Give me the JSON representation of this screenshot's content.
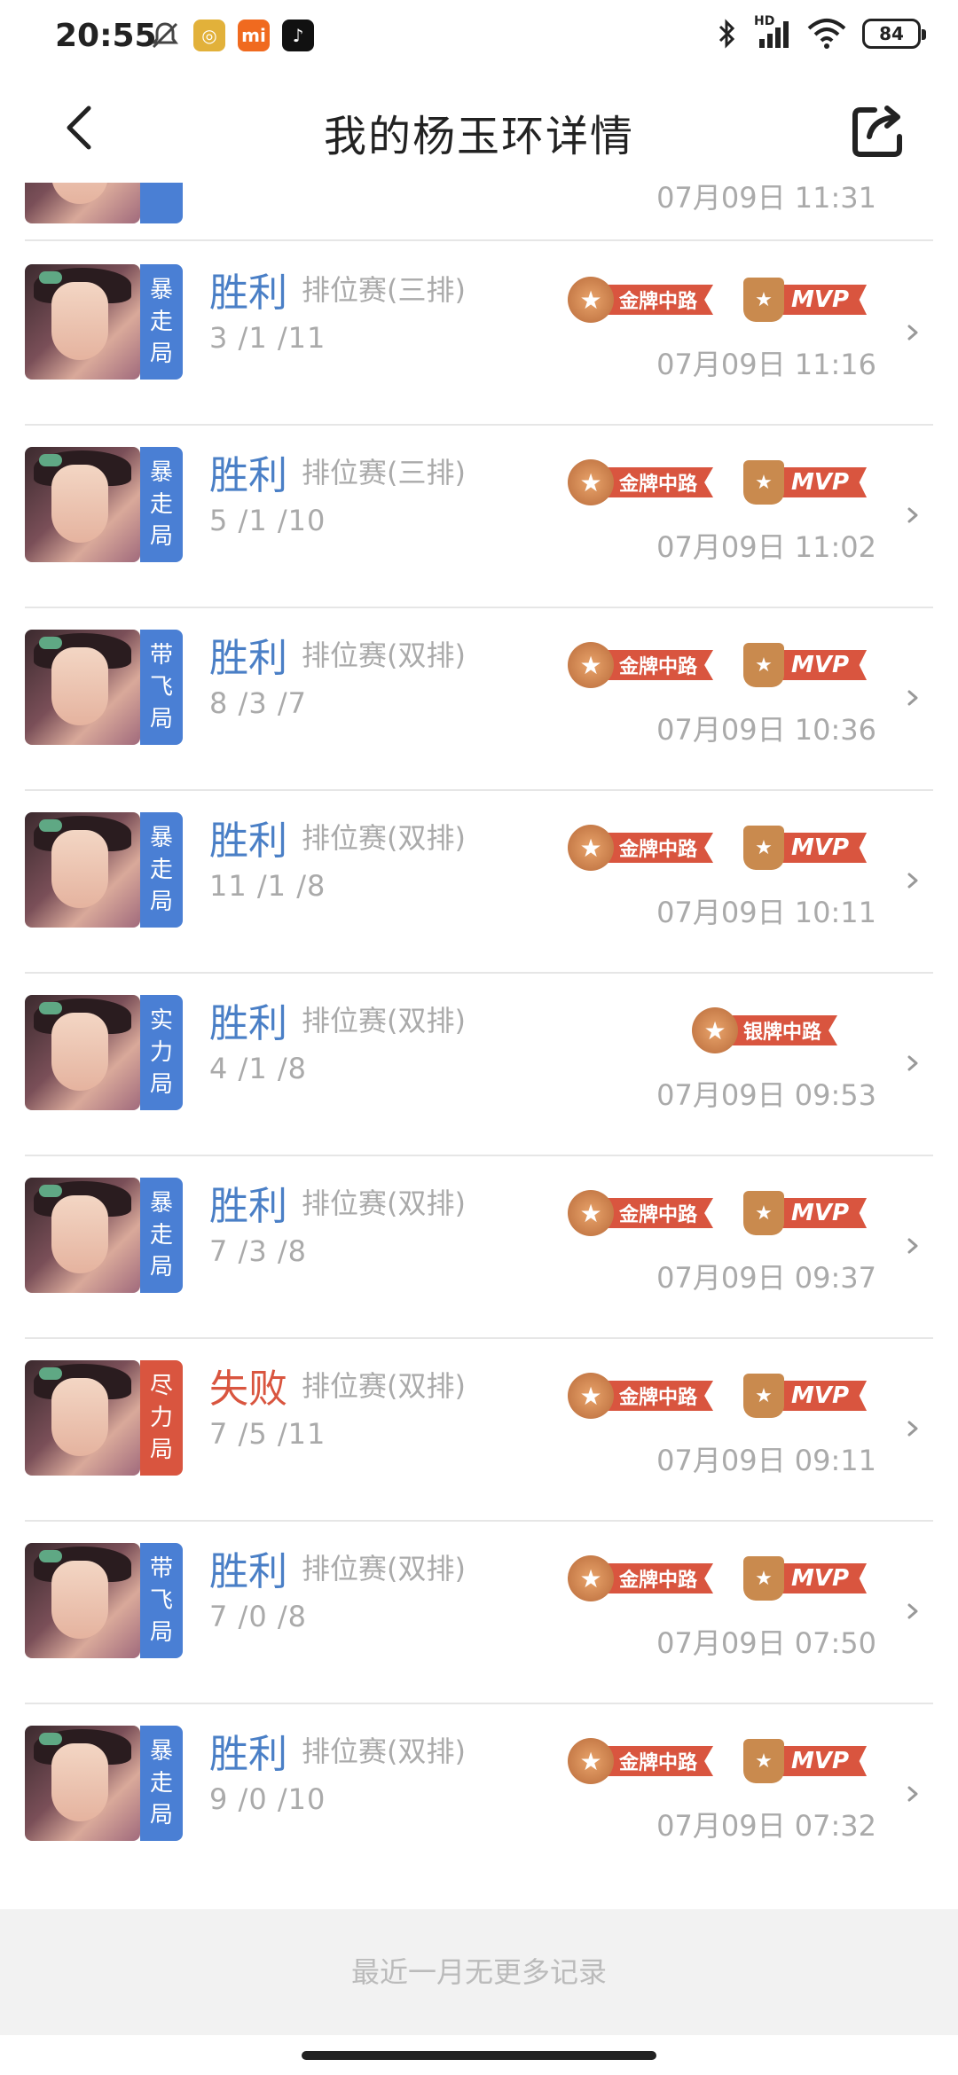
{
  "status_bar": {
    "time": "20:55",
    "network": "HD",
    "battery": "84"
  },
  "header": {
    "title": "我的杨玉环详情"
  },
  "partial_row": {
    "time": "07月09日 11:31"
  },
  "matches": [
    {
      "tag": [
        "暴",
        "走",
        "局"
      ],
      "tag_color": "#4a7fd4",
      "result": "胜利",
      "result_type": "win",
      "mode": "排位赛(三排)",
      "kda": "3 /1 /11",
      "time": "07月09日 11:16",
      "medal": "金牌中路",
      "mvp": "MVP"
    },
    {
      "tag": [
        "暴",
        "走",
        "局"
      ],
      "tag_color": "#4a7fd4",
      "result": "胜利",
      "result_type": "win",
      "mode": "排位赛(三排)",
      "kda": "5 /1 /10",
      "time": "07月09日 11:02",
      "medal": "金牌中路",
      "mvp": "MVP"
    },
    {
      "tag": [
        "带",
        "飞",
        "局"
      ],
      "tag_color": "#4a7fd4",
      "result": "胜利",
      "result_type": "win",
      "mode": "排位赛(双排)",
      "kda": "8 /3 /7",
      "time": "07月09日 10:36",
      "medal": "金牌中路",
      "mvp": "MVP"
    },
    {
      "tag": [
        "暴",
        "走",
        "局"
      ],
      "tag_color": "#4a7fd4",
      "result": "胜利",
      "result_type": "win",
      "mode": "排位赛(双排)",
      "kda": "11 /1 /8",
      "time": "07月09日 10:11",
      "medal": "金牌中路",
      "mvp": "MVP"
    },
    {
      "tag": [
        "实",
        "力",
        "局"
      ],
      "tag_color": "#4a7fd4",
      "result": "胜利",
      "result_type": "win",
      "mode": "排位赛(双排)",
      "kda": "4 /1 /8",
      "time": "07月09日 09:53",
      "medal": "银牌中路",
      "mvp": ""
    },
    {
      "tag": [
        "暴",
        "走",
        "局"
      ],
      "tag_color": "#4a7fd4",
      "result": "胜利",
      "result_type": "win",
      "mode": "排位赛(双排)",
      "kda": "7 /3 /8",
      "time": "07月09日 09:37",
      "medal": "金牌中路",
      "mvp": "MVP"
    },
    {
      "tag": [
        "尽",
        "力",
        "局"
      ],
      "tag_color": "#d9553f",
      "result": "失败",
      "result_type": "lose",
      "mode": "排位赛(双排)",
      "kda": "7 /5 /11",
      "time": "07月09日 09:11",
      "medal": "金牌中路",
      "mvp": "MVP"
    },
    {
      "tag": [
        "带",
        "飞",
        "局"
      ],
      "tag_color": "#4a7fd4",
      "result": "胜利",
      "result_type": "win",
      "mode": "排位赛(双排)",
      "kda": "7 /0 /8",
      "time": "07月09日 07:50",
      "medal": "金牌中路",
      "mvp": "MVP"
    },
    {
      "tag": [
        "暴",
        "走",
        "局"
      ],
      "tag_color": "#4a7fd4",
      "result": "胜利",
      "result_type": "win",
      "mode": "排位赛(双排)",
      "kda": "9 /0 /10",
      "time": "07月09日 07:32",
      "medal": "金牌中路",
      "mvp": "MVP"
    }
  ],
  "footer": {
    "text": "最近一月无更多记录"
  }
}
